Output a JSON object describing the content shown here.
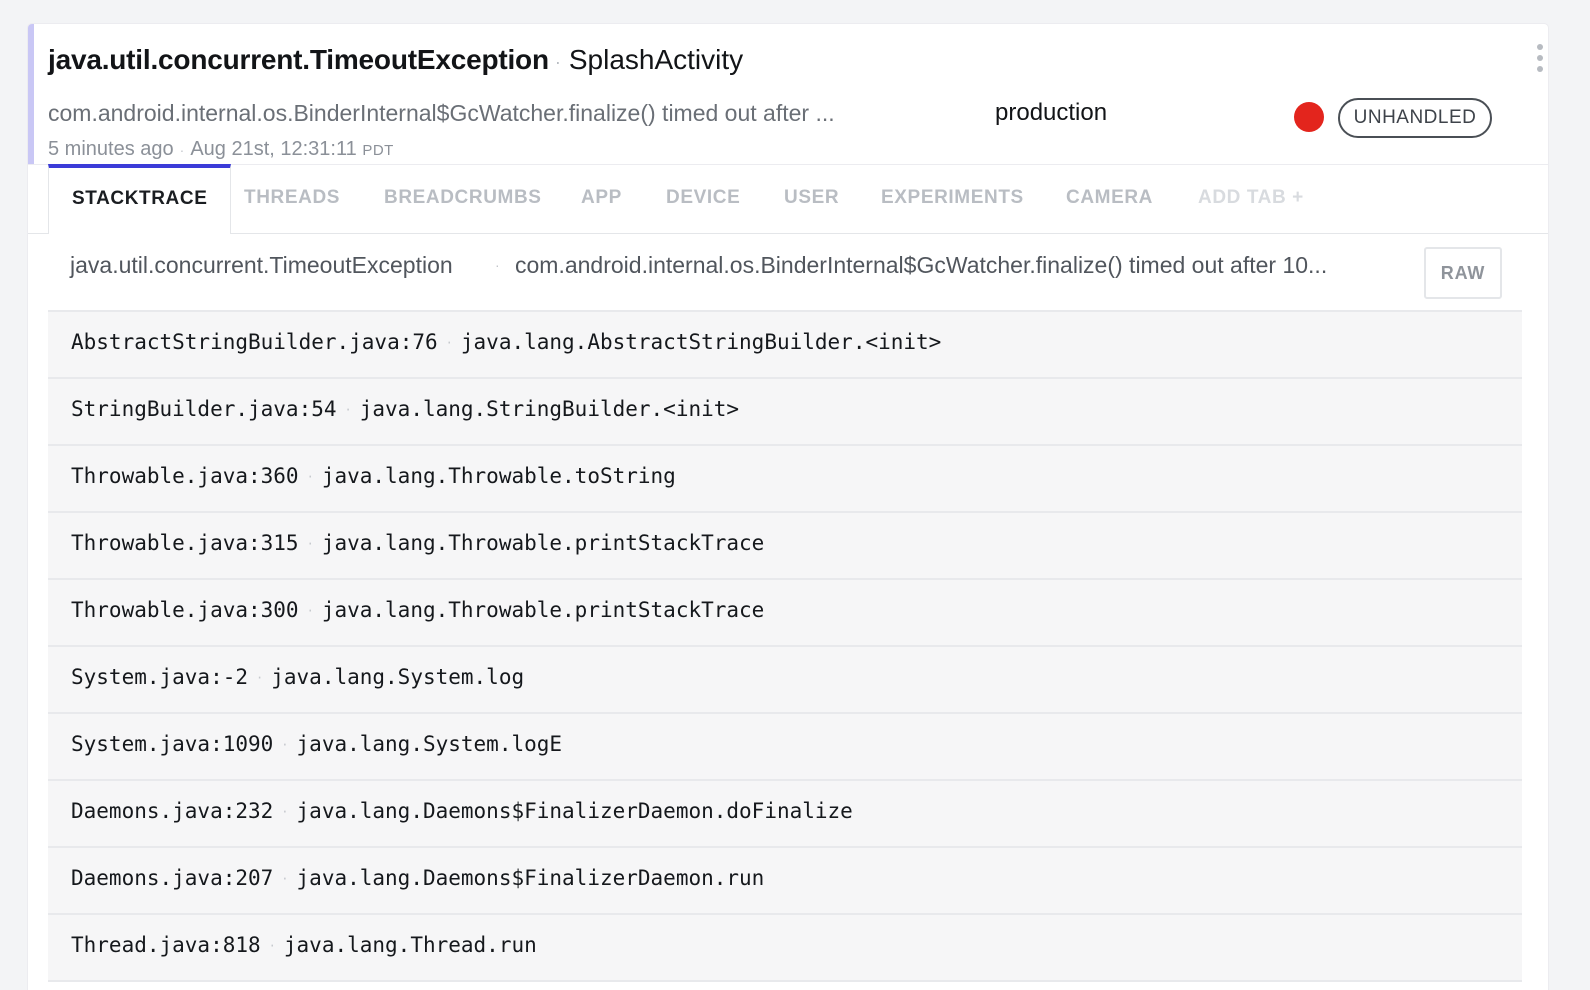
{
  "header": {
    "error_class": "java.util.concurrent.TimeoutException",
    "context": "SplashActivity",
    "message": "com.android.internal.os.BinderInternal$GcWatcher.finalize() timed out after ...",
    "time_ago": "5 minutes ago",
    "timestamp": "Aug 21st, 12:31:11",
    "timezone": "PDT",
    "release_stage": "production",
    "severity_color": "#e3251d",
    "handled_badge": "UNHANDLED",
    "menu_icon": "kebab-icon"
  },
  "tabs": [
    {
      "label": "STACKTRACE",
      "active": true
    },
    {
      "label": "THREADS"
    },
    {
      "label": "BREADCRUMBS"
    },
    {
      "label": "APP"
    },
    {
      "label": "DEVICE"
    },
    {
      "label": "USER"
    },
    {
      "label": "EXPERIMENTS"
    },
    {
      "label": "CAMERA"
    },
    {
      "label": "ADD TAB +"
    }
  ],
  "stacktrace": {
    "error_class": "java.util.concurrent.TimeoutException",
    "message": "com.android.internal.os.BinderInternal$GcWatcher.finalize() timed out after 10...",
    "raw_label": "RAW",
    "frames": [
      {
        "file": "AbstractStringBuilder.java:76",
        "method": "java.lang.AbstractStringBuilder.<init>"
      },
      {
        "file": "StringBuilder.java:54",
        "method": "java.lang.StringBuilder.<init>"
      },
      {
        "file": "Throwable.java:360",
        "method": "java.lang.Throwable.toString"
      },
      {
        "file": "Throwable.java:315",
        "method": "java.lang.Throwable.printStackTrace"
      },
      {
        "file": "Throwable.java:300",
        "method": "java.lang.Throwable.printStackTrace"
      },
      {
        "file": "System.java:-2",
        "method": "java.lang.System.log"
      },
      {
        "file": "System.java:1090",
        "method": "java.lang.System.logE"
      },
      {
        "file": "Daemons.java:232",
        "method": "java.lang.Daemons$FinalizerDaemon.doFinalize"
      },
      {
        "file": "Daemons.java:207",
        "method": "java.lang.Daemons$FinalizerDaemon.run"
      },
      {
        "file": "Thread.java:818",
        "method": "java.lang.Thread.run"
      }
    ]
  },
  "colors": {
    "accent": "#3b3bd8",
    "accent_bar": "#c9c7f5"
  }
}
